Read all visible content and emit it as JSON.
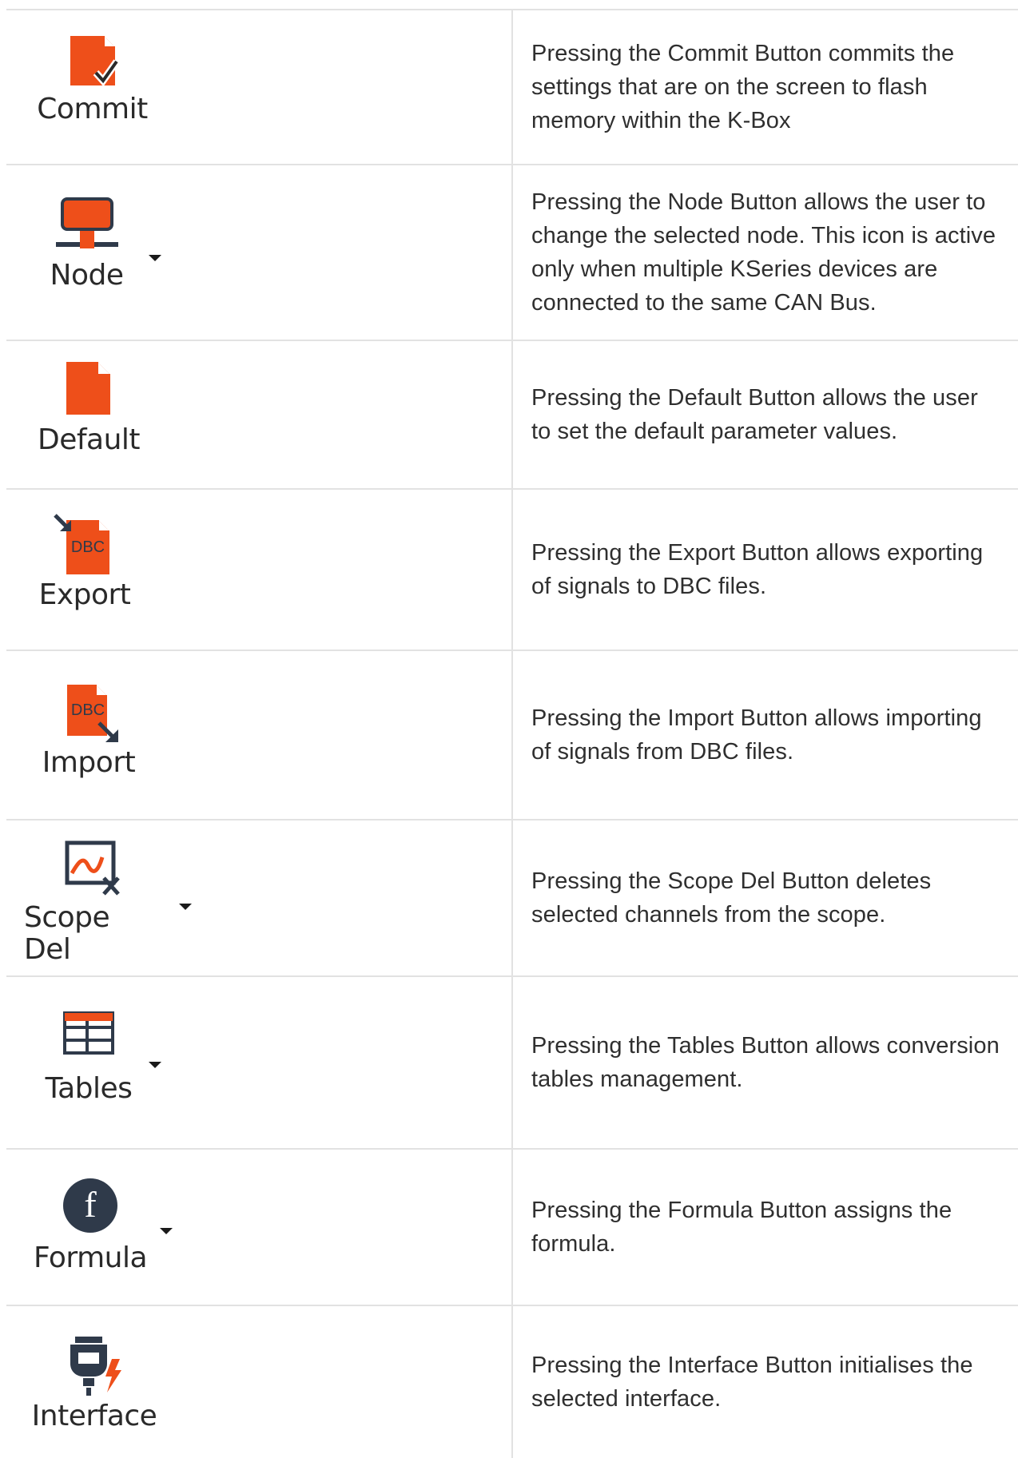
{
  "rows": [
    {
      "label": "Commit",
      "icon": "commit-icon",
      "has_dropdown": false,
      "description": "Pressing the Commit Button commits the settings that are on the screen to flash memory within the K-Box"
    },
    {
      "label": "Node",
      "icon": "node-icon",
      "has_dropdown": true,
      "description": "Pressing the Node Button allows the user to change the selected node. This icon is active only when multiple KSeries devices are connected to the same CAN Bus."
    },
    {
      "label": "Default",
      "icon": "default-icon",
      "has_dropdown": false,
      "description": "Pressing the Default Button allows the user to set the default parameter values."
    },
    {
      "label": "Export",
      "icon": "export-dbc-icon",
      "has_dropdown": false,
      "description": "Pressing the Export Button allows exporting of signals to DBC files."
    },
    {
      "label": "Import",
      "icon": "import-dbc-icon",
      "has_dropdown": false,
      "description": "Pressing the Import Button allows importing of signals from DBC files."
    },
    {
      "label": "Scope Del",
      "icon": "scope-delete-icon",
      "has_dropdown": true,
      "description": "Pressing the Scope Del Button deletes selected channels from the scope."
    },
    {
      "label": "Tables",
      "icon": "table-icon",
      "has_dropdown": true,
      "description": "Pressing the Tables Button allows conversion tables management."
    },
    {
      "label": "Formula",
      "icon": "formula-icon",
      "has_dropdown": true,
      "description": "Pressing the Formula Button assigns the formula."
    },
    {
      "label": "Interface",
      "icon": "interface-icon",
      "has_dropdown": false,
      "description": "Pressing the Interface Button initialises the selected interface."
    }
  ],
  "icon_text": {
    "dbc": "DBC",
    "formula": "f"
  },
  "colors": {
    "accent": "#EE4F1A",
    "dark": "#2F3A4A",
    "border": "#E2E2E2"
  }
}
